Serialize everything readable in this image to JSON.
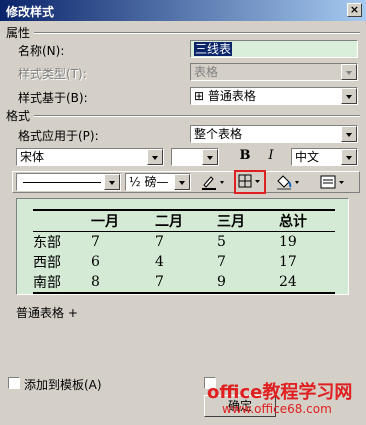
{
  "window": {
    "title": "修改样式",
    "close_label": "×"
  },
  "properties": {
    "section_label": "属性",
    "name_label": "名称(N):",
    "name_value": "三线表",
    "style_type_label": "样式类型(T):",
    "style_type_value": "表格",
    "based_on_label": "样式基于(B):",
    "based_on_value": "⊞ 普通表格"
  },
  "format": {
    "section_label": "格式",
    "apply_to_label": "格式应用于(P):",
    "apply_to_value": "整个表格",
    "font_value": "宋体",
    "size_value": "",
    "bold_label": "B",
    "italic_label": "I",
    "lang_value": "中文",
    "line_width_value": "½ 磅",
    "line_width_suffix": "—"
  },
  "preview": {
    "header": [
      "",
      "一月",
      "二月",
      "三月",
      "总计"
    ],
    "rows": [
      [
        "东部",
        "7",
        "7",
        "5",
        "19"
      ],
      [
        "西部",
        "6",
        "4",
        "7",
        "17"
      ],
      [
        "南部",
        "8",
        "7",
        "9",
        "24"
      ]
    ]
  },
  "description": "普通表格 +",
  "footer": {
    "add_template_label": "添加到模板(A)",
    "ok_label": "确定"
  },
  "watermark": {
    "line1": "office教程学习网",
    "line2": "www.office68.com"
  },
  "colors": {
    "accent_highlight": "#e02020",
    "preview_bg": "#d4ead4",
    "title_bar": "#0a246a"
  }
}
